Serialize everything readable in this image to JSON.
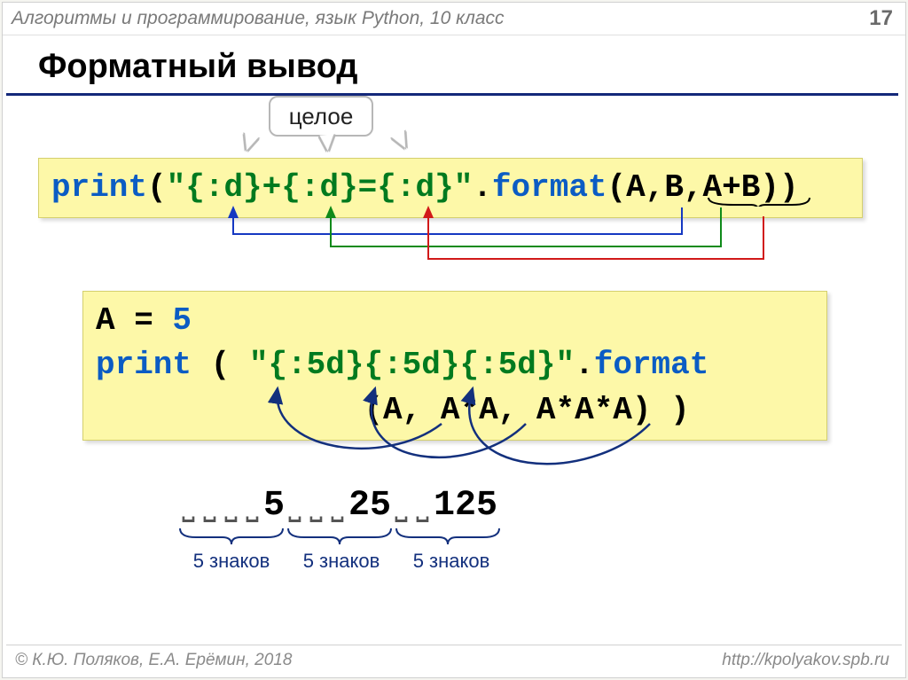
{
  "header": {
    "breadcrumb": "Алгоритмы и программирование, язык Python, 10 класс",
    "page": "17"
  },
  "title": "Форматный вывод",
  "callout": "целое",
  "code1": {
    "kw_print": "print",
    "open": "(",
    "str": "\"{:d}+{:d}={:d}\"",
    "dot": ".",
    "kw_format": "format",
    "args": "(A,B,A+B))"
  },
  "code2": {
    "line1_l": "A = ",
    "line1_n": "5",
    "kw_print": "print",
    "open": " ( ",
    "str": "\"{:5d}{:5d}{:5d}\"",
    "dot": ".",
    "kw_format": "format",
    "line3": "              (A, A*A, A*A*A) )"
  },
  "output": {
    "spacer": "␣",
    "cells": [
      "",
      "",
      "",
      "",
      "5",
      "",
      "",
      "",
      "2",
      "5",
      "",
      "",
      "1",
      "2",
      "5"
    ]
  },
  "brace_label": "5 знаков",
  "footer": {
    "left": "© К.Ю. Поляков, Е.А. Ерёмин, 2018",
    "right": "http://kpolyakov.spb.ru"
  }
}
